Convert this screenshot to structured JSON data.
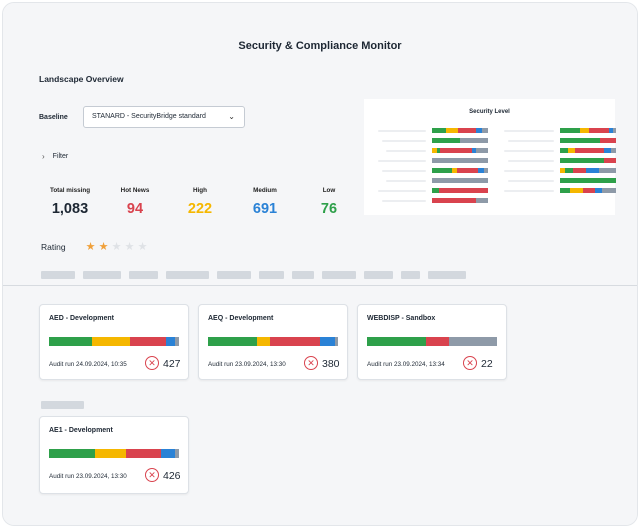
{
  "header": {
    "title": "Security & Compliance Monitor",
    "subtitle": "Landscape Overview"
  },
  "baseline": {
    "label": "Baseline",
    "selected": "STANARD - SecurityBridge standard"
  },
  "filter": {
    "label": "Filter"
  },
  "stats": [
    {
      "label": "Total missing",
      "value": "1,083",
      "color": "#1d2733"
    },
    {
      "label": "Hot News",
      "value": "94",
      "color": "#d9434e"
    },
    {
      "label": "High",
      "value": "222",
      "color": "#f5b700"
    },
    {
      "label": "Medium",
      "value": "691",
      "color": "#2a82d6"
    },
    {
      "label": "Low",
      "value": "76",
      "color": "#2ea04a"
    }
  ],
  "rating": {
    "label": "Rating",
    "value": 2,
    "max": 5
  },
  "security_level": {
    "title": "Security Level"
  },
  "colors": {
    "green": "#2ea04a",
    "yellow": "#f5b700",
    "red": "#d9434e",
    "blue": "#2a82d6",
    "gray": "#8e9aa8",
    "star_on": "#f0a03a",
    "star_off": "#dfe2e6"
  },
  "systems": [
    {
      "name": "AED - Development",
      "audit": "Audit run 24.09.2024, 10:35",
      "count": "427"
    },
    {
      "name": "AEQ - Development",
      "audit": "Audit run 23.09.2024, 13:30",
      "count": "380"
    },
    {
      "name": "WEBDISP - Sandbox",
      "audit": "Audit run 23.09.2024, 13:34",
      "count": "22"
    },
    {
      "name": "AE1 - Development",
      "audit": "Audit run 23.09.2024, 13:30",
      "count": "426"
    }
  ],
  "icons": {
    "dropdown": "chevron-down-icon",
    "filter": "chevron-right-icon",
    "findings": "circle-x-icon"
  }
}
